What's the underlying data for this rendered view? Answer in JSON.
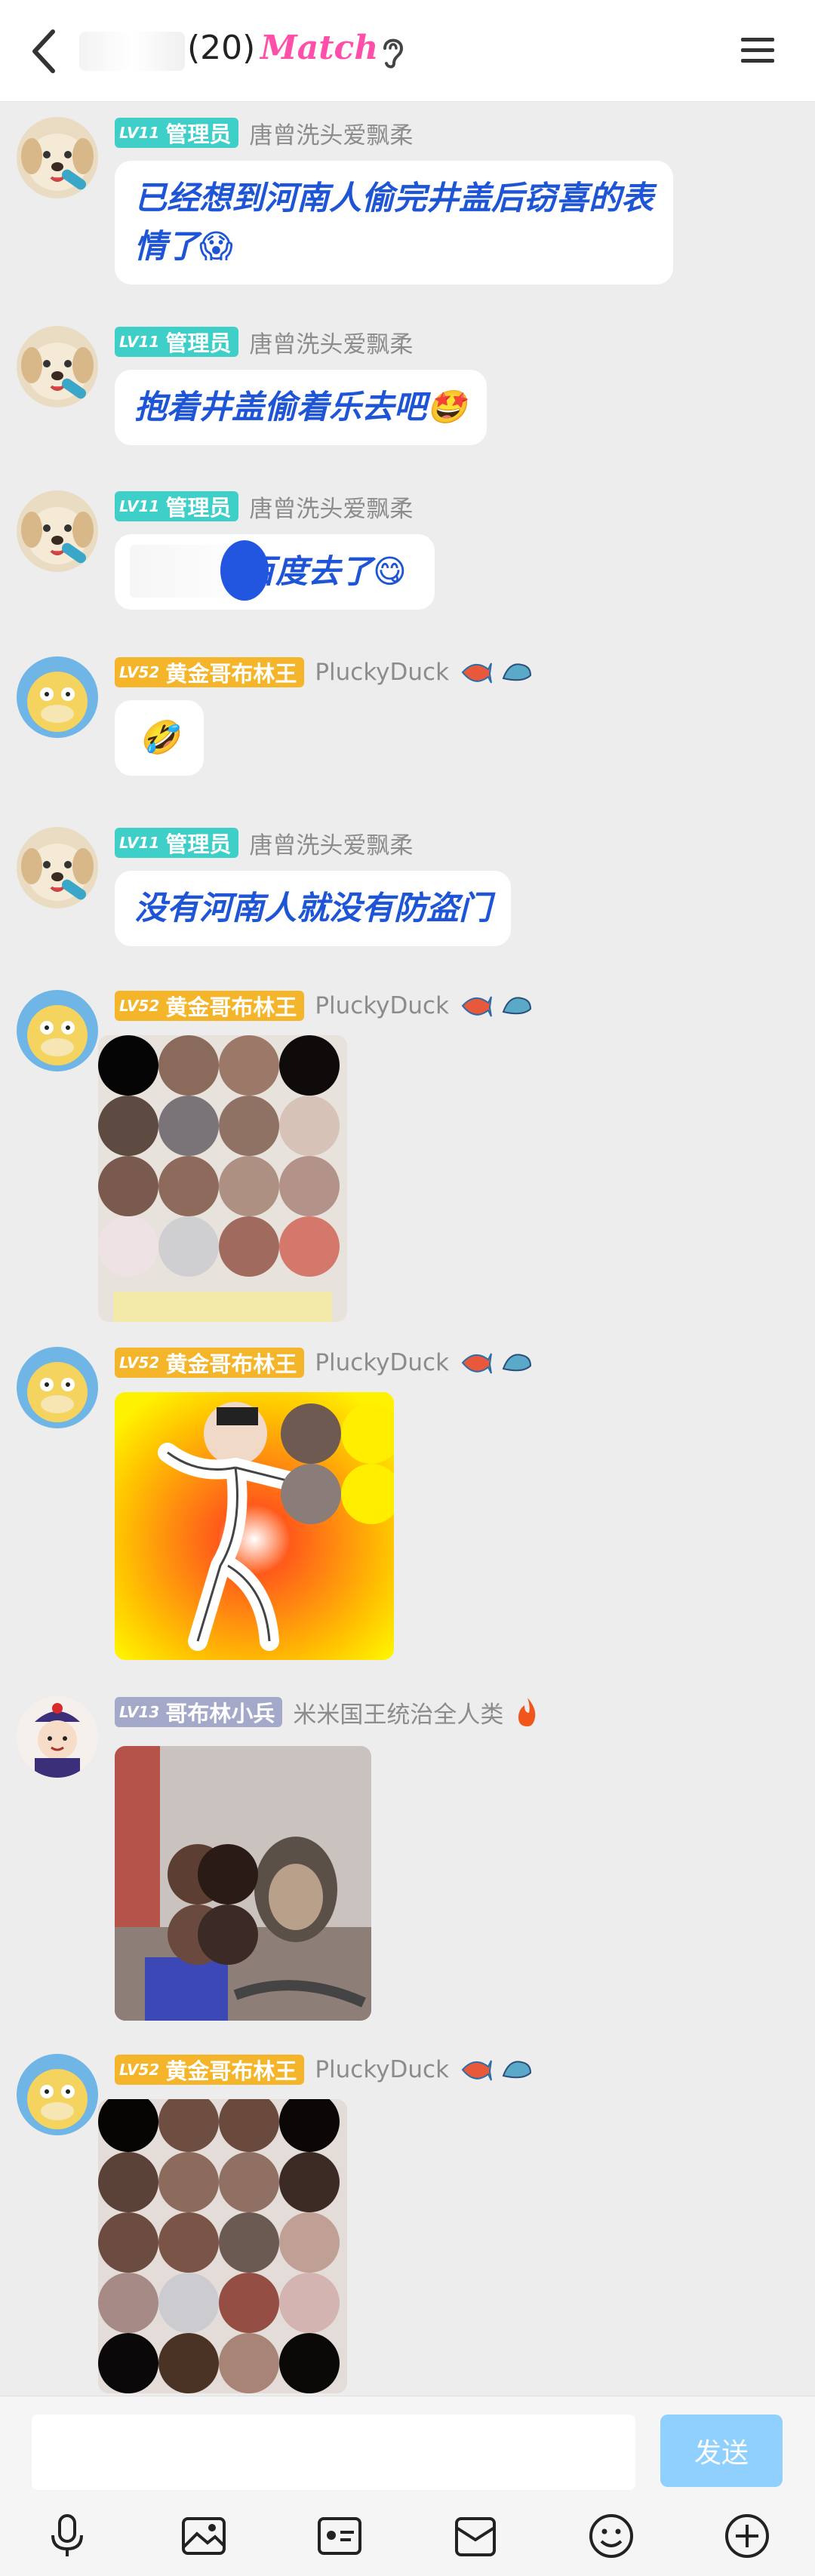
{
  "header": {
    "member_count": "(20)",
    "logo_text": "Match"
  },
  "messages": [
    {
      "user": "唐曾洗头爱飘柔",
      "badge_level": "LV11",
      "badge_title": "管理员",
      "text": "已经想到河南人偷完井盖后窃喜的表情了😱"
    },
    {
      "user": "唐曾洗头爱飘柔",
      "badge_level": "LV11",
      "badge_title": "管理员",
      "text": "抱着井盖偷着乐去吧🤩"
    },
    {
      "user": "唐曾洗头爱飘柔",
      "badge_level": "LV11",
      "badge_title": "管理员",
      "text": "百度去了😋"
    },
    {
      "user": "PluckyDuck",
      "badge_level": "LV52",
      "badge_title": "黄金哥布林王",
      "text": "🤣"
    },
    {
      "user": "唐曾洗头爱飘柔",
      "badge_level": "LV11",
      "badge_title": "管理员",
      "text": "没有河南人就没有防盗门"
    },
    {
      "user": "PluckyDuck",
      "badge_level": "LV52",
      "badge_title": "黄金哥布林王"
    },
    {
      "user": "PluckyDuck",
      "badge_level": "LV52",
      "badge_title": "黄金哥布林王"
    },
    {
      "user": "米米国王统治全人类",
      "badge_level": "LV13",
      "badge_title": "哥布林小兵",
      "user_suffix_icon": "fire-icon"
    },
    {
      "user": "PluckyDuck",
      "badge_level": "LV52",
      "badge_title": "黄金哥布林王"
    }
  ],
  "input": {
    "send_label": "发送"
  },
  "colors": {
    "bubble_text": "#1e55d6",
    "admin_badge": "#3fcfc9",
    "gold_badge": "#f5b52a",
    "soldier_badge": "#a5a9c9",
    "send_button": "#8fd0ff",
    "logo": "#ff4fa8"
  },
  "icons": {
    "header": [
      "back-arrow-icon",
      "ear-icon",
      "menu-icon"
    ],
    "toolbar": [
      "microphone-icon",
      "image-icon",
      "photo-card-icon",
      "gift-box-icon",
      "emoji-icon",
      "plus-circle-icon"
    ]
  }
}
